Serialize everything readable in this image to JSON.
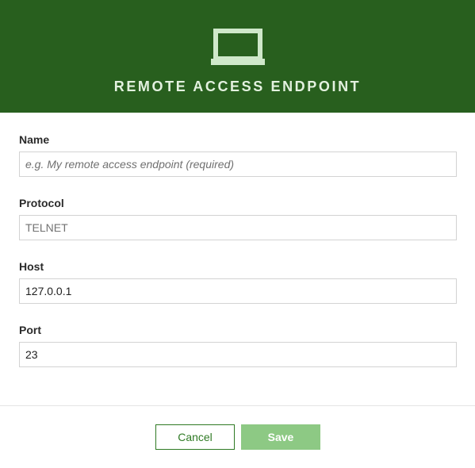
{
  "dialog": {
    "title": "REMOTE ACCESS ENDPOINT",
    "icon": "laptop-icon"
  },
  "form": {
    "name": {
      "label": "Name",
      "value": "",
      "placeholder": "e.g. My remote access endpoint (required)"
    },
    "protocol": {
      "label": "Protocol",
      "value": "TELNET"
    },
    "host": {
      "label": "Host",
      "value": "127.0.0.1"
    },
    "port": {
      "label": "Port",
      "value": "23"
    }
  },
  "actions": {
    "cancel_label": "Cancel",
    "save_label": "Save"
  },
  "colors": {
    "header_bg": "#285f1e",
    "header_text": "#e3f1df",
    "accent": "#2f7a24",
    "save_disabled_bg": "#8dc984"
  }
}
